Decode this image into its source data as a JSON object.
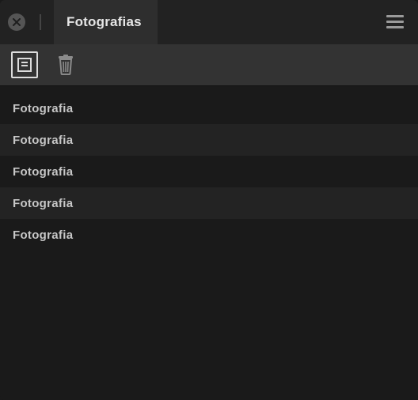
{
  "titlebar": {
    "tab_label": "Fotografias"
  },
  "toolbar": {
    "icons": {
      "properties": "properties-icon",
      "delete": "delete-icon"
    }
  },
  "list": {
    "items": [
      {
        "label": "Fotografia"
      },
      {
        "label": "Fotografia"
      },
      {
        "label": "Fotografia"
      },
      {
        "label": "Fotografia"
      },
      {
        "label": "Fotografia"
      }
    ]
  }
}
